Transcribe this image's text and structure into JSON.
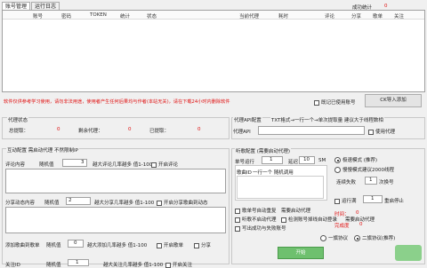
{
  "tabs": [
    "账号管理",
    "运行日志"
  ],
  "success_label": "成功统计",
  "success_count": "0",
  "grid_headers": [
    "账号",
    "密码",
    "TOKEN",
    "统计",
    "状态",
    "当前代理",
    "耗时",
    "评论",
    "分享",
    "歌单",
    "关注"
  ],
  "notice": "软件仅供参考学习使用，请勿非法用途，使用者产生任何后果均与作者(本站无关)，请在下载24小时内删除软件",
  "use_only_label": "既记已使用账号",
  "import_button": "CK导入添加",
  "proxy_status": {
    "title": "代理状态",
    "total_label": "总提取：",
    "total": "0",
    "remaining_label": "剩余代理：",
    "remaining": "0",
    "used_label": "已提取：",
    "used": "0"
  },
  "proxy_api": {
    "title": "代理API配置",
    "desc": "TXT格式→一行一个→单次提取量 建议大于线程数相",
    "api_label": "代理API",
    "use_proxy_label": "使用代理"
  },
  "interaction": {
    "title": "互动配置 需启动代理 不然限制IP",
    "comment_label": "评论内容",
    "comment_rand": "随机值",
    "comment_val": "3",
    "comment_desc": "越大评论几率越多 值1-100",
    "comment_enable": "开启评论",
    "share_label": "分享动态内容",
    "share_rand": "随机值",
    "share_val": "2",
    "share_desc": "越大分享几率越多 值1-100",
    "share_enable": "开启分享歌曲到动态",
    "playlist_label": "添加歌曲到歌单",
    "playlist_rand": "随机值",
    "playlist_val": "0",
    "playlist_desc": "越大添加几率越多 值1-100",
    "playlist_enable": "开启歌单",
    "playlist_share": "分享",
    "follow_label": "关注ID",
    "follow_rand": "随机值",
    "follow_val": "1",
    "follow_desc": "越大关注几率越多 值1-100",
    "follow_enable": "开启关注"
  },
  "listen": {
    "title": "听歌配置 (需要启动代理)",
    "single_label": "单号运行",
    "single_val": "1",
    "delay_label": "延迟",
    "delay_val": "10",
    "delay_unit": "SM",
    "playlist_id_label": "歌曲ID",
    "playlist_id_desc": "一行一个 随机调用",
    "auto_replace_label": "歌单号自动重复",
    "need_proxy_label": "需要启动代理",
    "no_proxy_label": "听歌不启动代理",
    "detect_label": "检测账号掉线自动登录",
    "need_proxy2": "需要启动代理",
    "write_fail_label": "写出成功与失败账号",
    "mode_fast": "极速模式 (推荐)",
    "mode_slow": "慢慢模式建议2000线程",
    "connect_label": "连续失败",
    "connect_val": "1",
    "connect_unit": "次换号",
    "run_interval_label": "运行满",
    "run_interval_val": "1",
    "run_interval_unit": "重启停止",
    "time_label": "时间：",
    "time_val": "0",
    "done_label": "完成度",
    "done_val": "0",
    "proto1": "一旗协议",
    "proto2": "二旗协议(推荐)",
    "start_button": "开始"
  }
}
